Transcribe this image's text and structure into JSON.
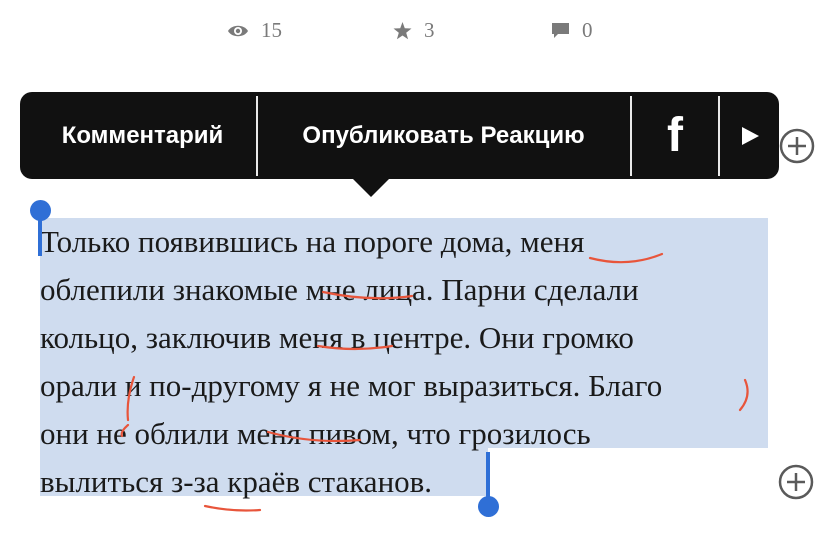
{
  "stats": {
    "views": "15",
    "stars": "3",
    "comments": "0"
  },
  "toolbar": {
    "comment_label": "Комментарий",
    "publish_label": "Опубликовать Реакцию",
    "facebook_glyph": "f"
  },
  "paragraph": {
    "lines": [
      "Только появившись на пороге дома, меня",
      "облепили знакомые мне лица. Парни сделали",
      "кольцо, заключив меня в центре. Они громко",
      "орали и по-другому я не мог выразиться. Благо",
      "они не облили меня пивом, что грозилось",
      "вылиться з-за краёв стаканов."
    ]
  },
  "colors": {
    "selection": "#cfdcef",
    "handle": "#2f6fd6",
    "spellcheck": "#e8553b",
    "toolbar_bg": "#111111"
  },
  "icons": [
    "eye-icon",
    "star-icon",
    "comment-icon",
    "facebook-icon",
    "play-icon",
    "plus-circle-icon"
  ]
}
